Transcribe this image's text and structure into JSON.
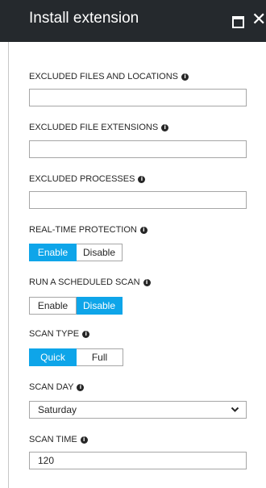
{
  "header": {
    "title": "Install extension"
  },
  "fields": {
    "excluded_files": {
      "label": "EXCLUDED FILES AND LOCATIONS",
      "value": ""
    },
    "excluded_extensions": {
      "label": "EXCLUDED FILE EXTENSIONS",
      "value": ""
    },
    "excluded_processes": {
      "label": "EXCLUDED PROCESSES",
      "value": ""
    },
    "realtime": {
      "label": "REAL-TIME PROTECTION",
      "options": [
        "Enable",
        "Disable"
      ],
      "selected": "Enable"
    },
    "scheduled": {
      "label": "RUN A SCHEDULED SCAN",
      "options": [
        "Enable",
        "Disable"
      ],
      "selected": "Disable"
    },
    "scan_type": {
      "label": "SCAN TYPE",
      "options": [
        "Quick",
        "Full"
      ],
      "selected": "Quick"
    },
    "scan_day": {
      "label": "SCAN DAY",
      "value": "Saturday"
    },
    "scan_time": {
      "label": "SCAN TIME",
      "value": "120"
    }
  },
  "colors": {
    "header_bg": "#25292d",
    "accent": "#0ea5e9"
  },
  "icons": {
    "maximize": "maximize-icon",
    "close": "close-icon",
    "info": "info-icon",
    "dropdown": "chevron-down-icon"
  }
}
